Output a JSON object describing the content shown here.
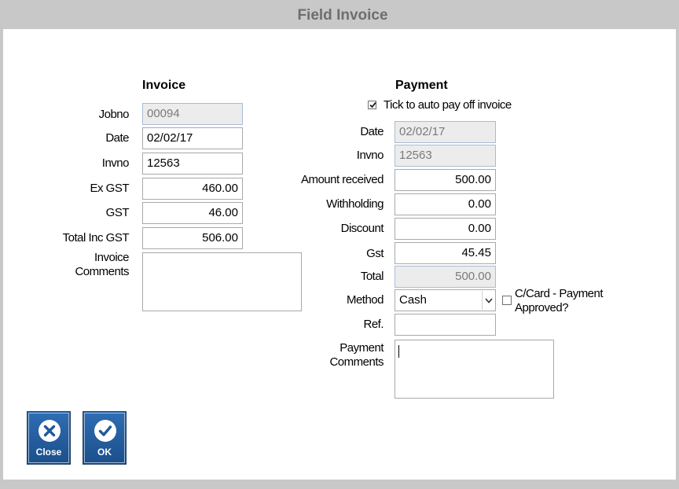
{
  "window": {
    "title": "Field Invoice"
  },
  "invoice": {
    "heading": "Invoice",
    "jobno_label": "Jobno",
    "jobno": "00094",
    "date_label": "Date",
    "date": "02/02/17",
    "invno_label": "Invno",
    "invno": "12563",
    "exgst_label": "Ex GST",
    "exgst": "460.00",
    "gst_label": "GST",
    "gst": "46.00",
    "total_label": "Total Inc GST",
    "total": "506.00",
    "comments_label_1": "Invoice",
    "comments_label_2": "Comments",
    "comments": ""
  },
  "payment": {
    "heading": "Payment",
    "auto_pay_label": "Tick to auto pay off invoice",
    "auto_pay_checked": true,
    "date_label": "Date",
    "date": "02/02/17",
    "invno_label": "Invno",
    "invno": "12563",
    "amount_label": "Amount received",
    "amount": "500.00",
    "withholding_label": "Withholding",
    "withholding": "0.00",
    "discount_label": "Discount",
    "discount": "0.00",
    "gst_label": "Gst",
    "gst": "45.45",
    "total_label": "Total",
    "total": "500.00",
    "method_label": "Method",
    "method": "Cash",
    "ccard_label_1": "C/Card - Payment",
    "ccard_label_2": "Approved?",
    "ccard_checked": false,
    "ref_label": "Ref.",
    "ref": "",
    "comments_label_1": "Payment",
    "comments_label_2": "Comments",
    "comments": ""
  },
  "buttons": {
    "close": "Close",
    "ok": "OK"
  },
  "colors": {
    "title_bar": "#c8c8c8",
    "button_blue": "#1b4f8c",
    "readonly_bg": "#ececec"
  }
}
